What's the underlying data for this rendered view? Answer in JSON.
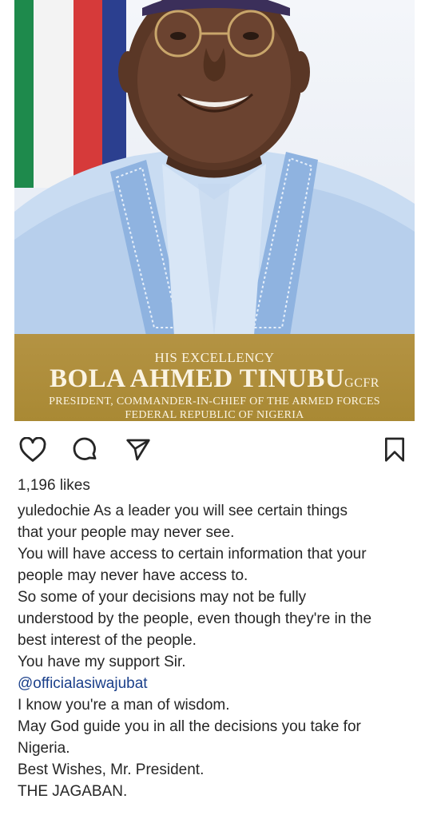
{
  "post": {
    "banner": {
      "honorific": "HIS EXCELLENCY",
      "name": "BOLA AHMED TINUBU",
      "name_suffix": "GCFR",
      "role": "PRESIDENT, COMMANDER-IN-CHIEF OF THE ARMED FORCES",
      "country": "FEDERAL REPUBLIC OF NIGERIA"
    },
    "colors": {
      "banner_gold": "#b08f3d",
      "banner_text": "#fbf4e3",
      "agbada_blue": "#bcd3ee",
      "mention_blue": "#1a3f8a"
    }
  },
  "actions": {
    "like_icon": "heart-icon",
    "comment_icon": "comment-icon",
    "share_icon": "send-icon",
    "save_icon": "bookmark-icon"
  },
  "likes": "1,196 likes",
  "caption": {
    "username": "yuledochie",
    "lines": [
      " As a leader you will see certain things",
      "that your people may never see.",
      "You will have access to certain information that your",
      "people may never have access to.",
      "So some of your decisions may not be fully",
      "understood by the people, even though they're in the",
      "best interest of the people.",
      "You have my support Sir."
    ],
    "mention": "@officialasiwajubat",
    "closing_lines": [
      "I know you're a man of wisdom.",
      "May God guide you in all the decisions you take for",
      "Nigeria.",
      "Best Wishes, Mr. President.",
      "THE JAGABAN."
    ]
  }
}
